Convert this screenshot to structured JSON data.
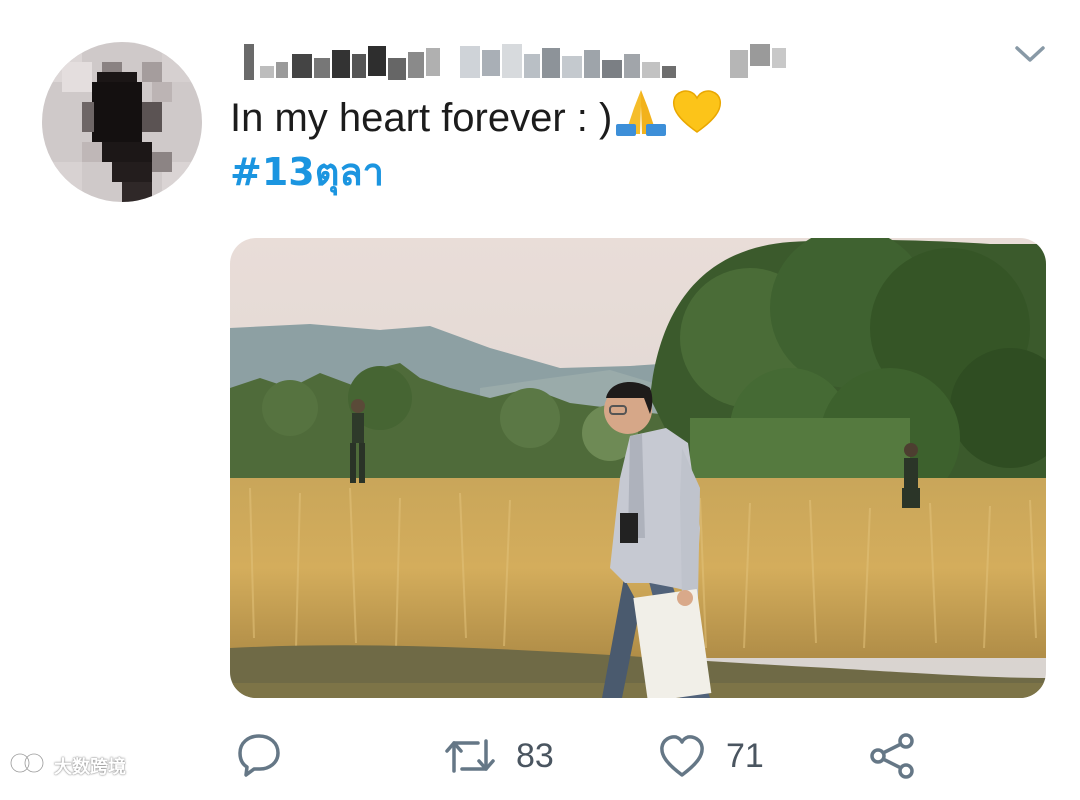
{
  "tweet": {
    "text": "In my heart forever : )",
    "emoji": [
      "folded-hands",
      "yellow-heart"
    ],
    "hashtag": "#13ตุลา"
  },
  "actions": {
    "retweets": "83",
    "likes": "71"
  },
  "icons": {
    "reply": "reply-icon",
    "retweet": "retweet-icon",
    "like": "heart-icon",
    "share": "share-icon",
    "menu": "chevron-down-icon"
  },
  "colors": {
    "link": "#1b95e0",
    "icon": "#657786"
  },
  "watermark": "大数跨境"
}
